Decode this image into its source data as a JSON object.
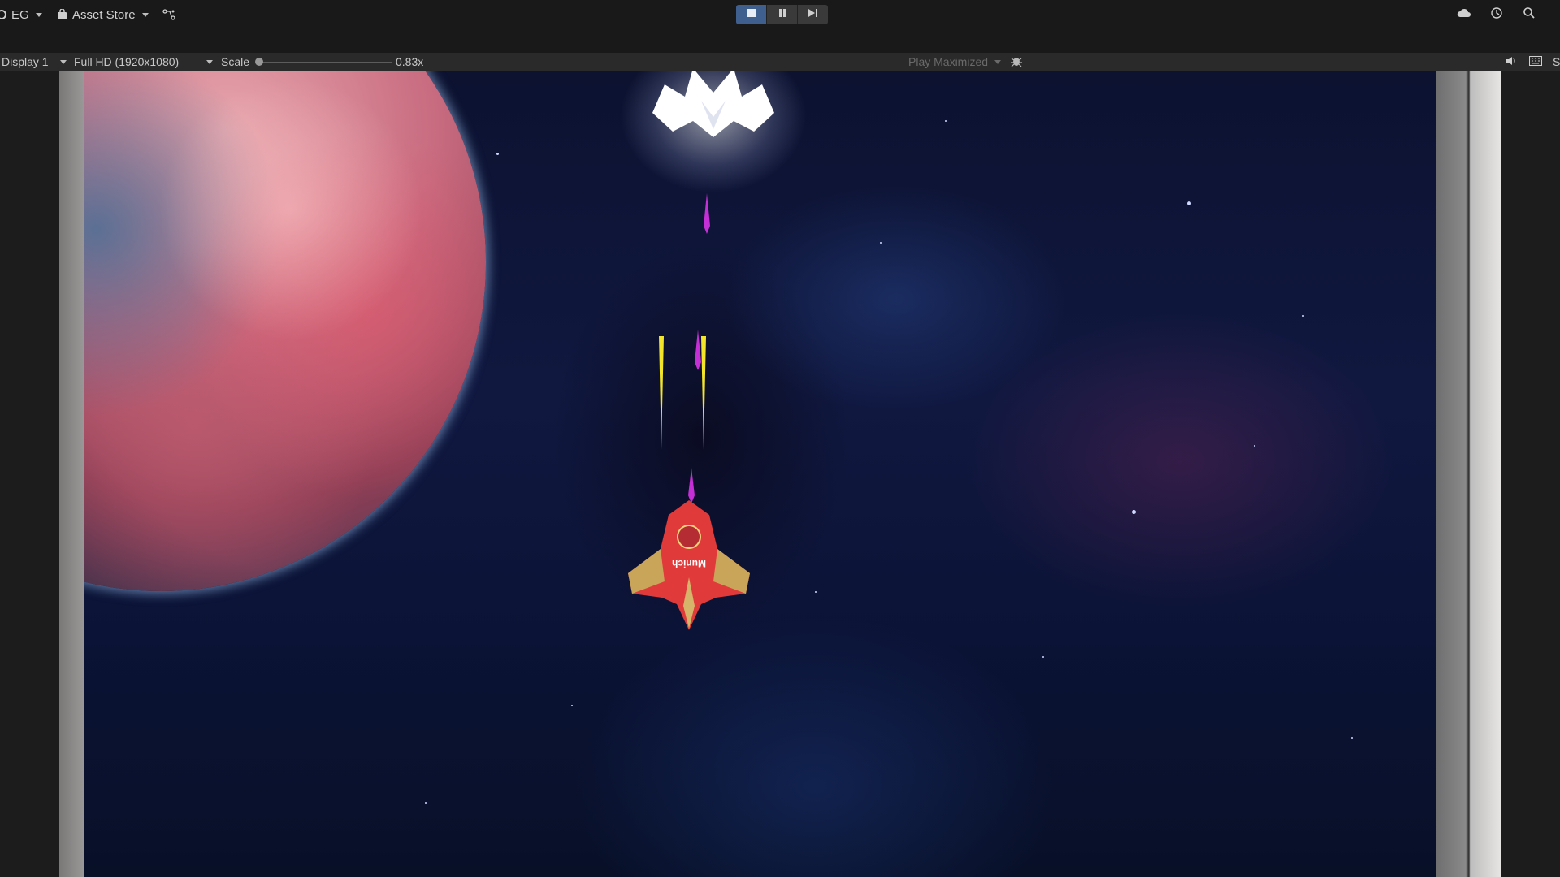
{
  "toolbar": {
    "account_label": "EG",
    "asset_store_label": "Asset Store",
    "icons": [
      "account-icon",
      "bag-icon",
      "branch-icon",
      "stop-icon",
      "pause-icon",
      "step-icon",
      "cloud-icon",
      "history-icon",
      "search-icon"
    ]
  },
  "gamebar": {
    "display_label": "Display 1",
    "resolution_label": "Full HD (1920x1080)",
    "scale_label": "Scale",
    "scale_value_label": "0.83x",
    "scale_value": 0.83,
    "play_mode_label": "Play Maximized",
    "right_letter": "S"
  },
  "game": {
    "ship_decal_text": "Munich"
  },
  "colors": {
    "play_active": "#3f5f8e",
    "toolbar_bg": "#191919",
    "gamebar_bg": "#2a2a2a",
    "laser_yellow": "#f2e52a",
    "laser_magenta": "#c42fd6",
    "ship_red": "#e03a3a"
  }
}
